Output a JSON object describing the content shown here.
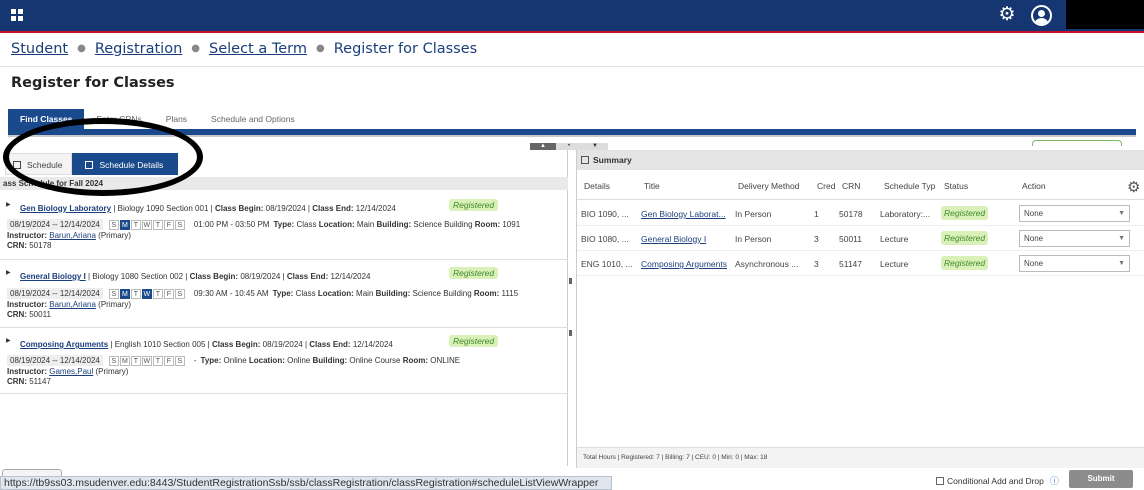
{
  "header": {
    "grid_icon": "grid-icon",
    "gear_icon": "gear-icon",
    "user_icon": "user-icon",
    "bar_color": "#153670",
    "accent_color": "#c8102e"
  },
  "breadcrumb": [
    "Student",
    "Registration",
    "Select a Term",
    "Register for Classes"
  ],
  "page_title": "Register for Classes",
  "tabs": [
    {
      "label": "Find Classes",
      "active": true
    },
    {
      "label": "Enter CRNs",
      "active": false
    },
    {
      "label": "Plans",
      "active": false
    },
    {
      "label": "Schedule and Options",
      "active": false
    }
  ],
  "schedule_panel": {
    "view_schedule": "Schedule",
    "view_details": "Schedule Details",
    "heading": "ass Schedule for Fall 2024",
    "sections": [
      {
        "title": "Gen Biology Laboratory",
        "title_shown": "Gen Biology Laboratory",
        "meta": "| Biology 1090 Section 001 |",
        "class_begin_label": "Class Begin:",
        "class_begin": "08/19/2024",
        "class_end_label": "Class End:",
        "class_end": "12/14/2024",
        "status": "Registered",
        "dates": "08/19/2024 -- 12/14/2024",
        "days": [
          {
            "d": "S",
            "on": false
          },
          {
            "d": "M",
            "on": true
          },
          {
            "d": "T",
            "on": false
          },
          {
            "d": "W",
            "on": false
          },
          {
            "d": "T",
            "on": false
          },
          {
            "d": "F",
            "on": false
          },
          {
            "d": "S",
            "on": false
          }
        ],
        "time": "01:00 PM - 03:50 PM",
        "type": "Class",
        "location": "Main",
        "building": "Science Building",
        "room": "1091",
        "instructor": "Barun,Ariana",
        "instructor_role": "(Primary)",
        "crn": "50178"
      },
      {
        "title": "General Biology I",
        "title_shown": "General Biology I",
        "meta": "| Biology 1080 Section 002 |",
        "class_begin_label": "Class Begin:",
        "class_begin": "08/19/2024",
        "class_end_label": "Class End:",
        "class_end": "12/14/2024",
        "status": "Registered",
        "dates": "08/19/2024 -- 12/14/2024",
        "days": [
          {
            "d": "S",
            "on": false
          },
          {
            "d": "M",
            "on": true
          },
          {
            "d": "T",
            "on": false
          },
          {
            "d": "W",
            "on": true
          },
          {
            "d": "T",
            "on": false
          },
          {
            "d": "F",
            "on": false
          },
          {
            "d": "S",
            "on": false
          }
        ],
        "time": "09:30 AM - 10:45 AM",
        "type": "Class",
        "location": "Main",
        "building": "Science Building",
        "room": "1115",
        "instructor": "Barun,Ariana",
        "instructor_role": "(Primary)",
        "crn": "50011"
      },
      {
        "title": "Composing Arguments",
        "title_shown": "Composing Arguments",
        "meta": "| English 1010 Section 005 |",
        "class_begin_label": "Class Begin:",
        "class_begin": "08/19/2024",
        "class_end_label": "Class End:",
        "class_end": "12/14/2024",
        "status": "Registered",
        "dates": "08/19/2024 -- 12/14/2024",
        "days": [
          {
            "d": "S",
            "on": false
          },
          {
            "d": "M",
            "on": false
          },
          {
            "d": "T",
            "on": false
          },
          {
            "d": "W",
            "on": false
          },
          {
            "d": "T",
            "on": false
          },
          {
            "d": "F",
            "on": false
          },
          {
            "d": "S",
            "on": false
          }
        ],
        "time": "-",
        "type": "Online",
        "location": "Online",
        "building": "Online Course",
        "room": "ONLINE",
        "instructor": "Games,Paul",
        "instructor_role": "(Primary)",
        "crn": "51147"
      }
    ],
    "labels": {
      "type": "Type:",
      "location": "Location:",
      "building": "Building:",
      "room": "Room:",
      "instructor": "Instructor:",
      "crn": "CRN:"
    }
  },
  "summary": {
    "title": "Summary",
    "columns": [
      "Details",
      "Title",
      "Delivery Method",
      "Cred",
      "CRN",
      "Schedule Typ",
      "Status",
      "Action"
    ],
    "rows": [
      {
        "details": "BIO 1090, ...",
        "title": "Gen Biology Laborat...",
        "delivery": "In Person",
        "cred": "1",
        "crn": "50178",
        "schedule_type": "Laboratory:...",
        "status": "Registered",
        "action": "None"
      },
      {
        "details": "BIO 1080, ...",
        "title": "General Biology I",
        "delivery": "In Person",
        "cred": "3",
        "crn": "50011",
        "schedule_type": "Lecture",
        "status": "Registered",
        "action": "None"
      },
      {
        "details": "ENG 1010, ...",
        "title": "Composing Arguments",
        "delivery": "Asynchronous ...",
        "cred": "3",
        "crn": "51147",
        "schedule_type": "Lecture",
        "status": "Registered",
        "action": "None"
      }
    ],
    "totals": "Total Hours | Registered: 7 | Billing: 7 | CEU: 0 | Min: 0 | Max: 18"
  },
  "footer": {
    "url": "https://tb9ss03.msudenver.edu:8443/StudentRegistrationSsb/ssb/classRegistration/classRegistration#scheduleListViewWrapper",
    "conditional_label": "Conditional Add and Drop",
    "submit_label": "Submit"
  }
}
